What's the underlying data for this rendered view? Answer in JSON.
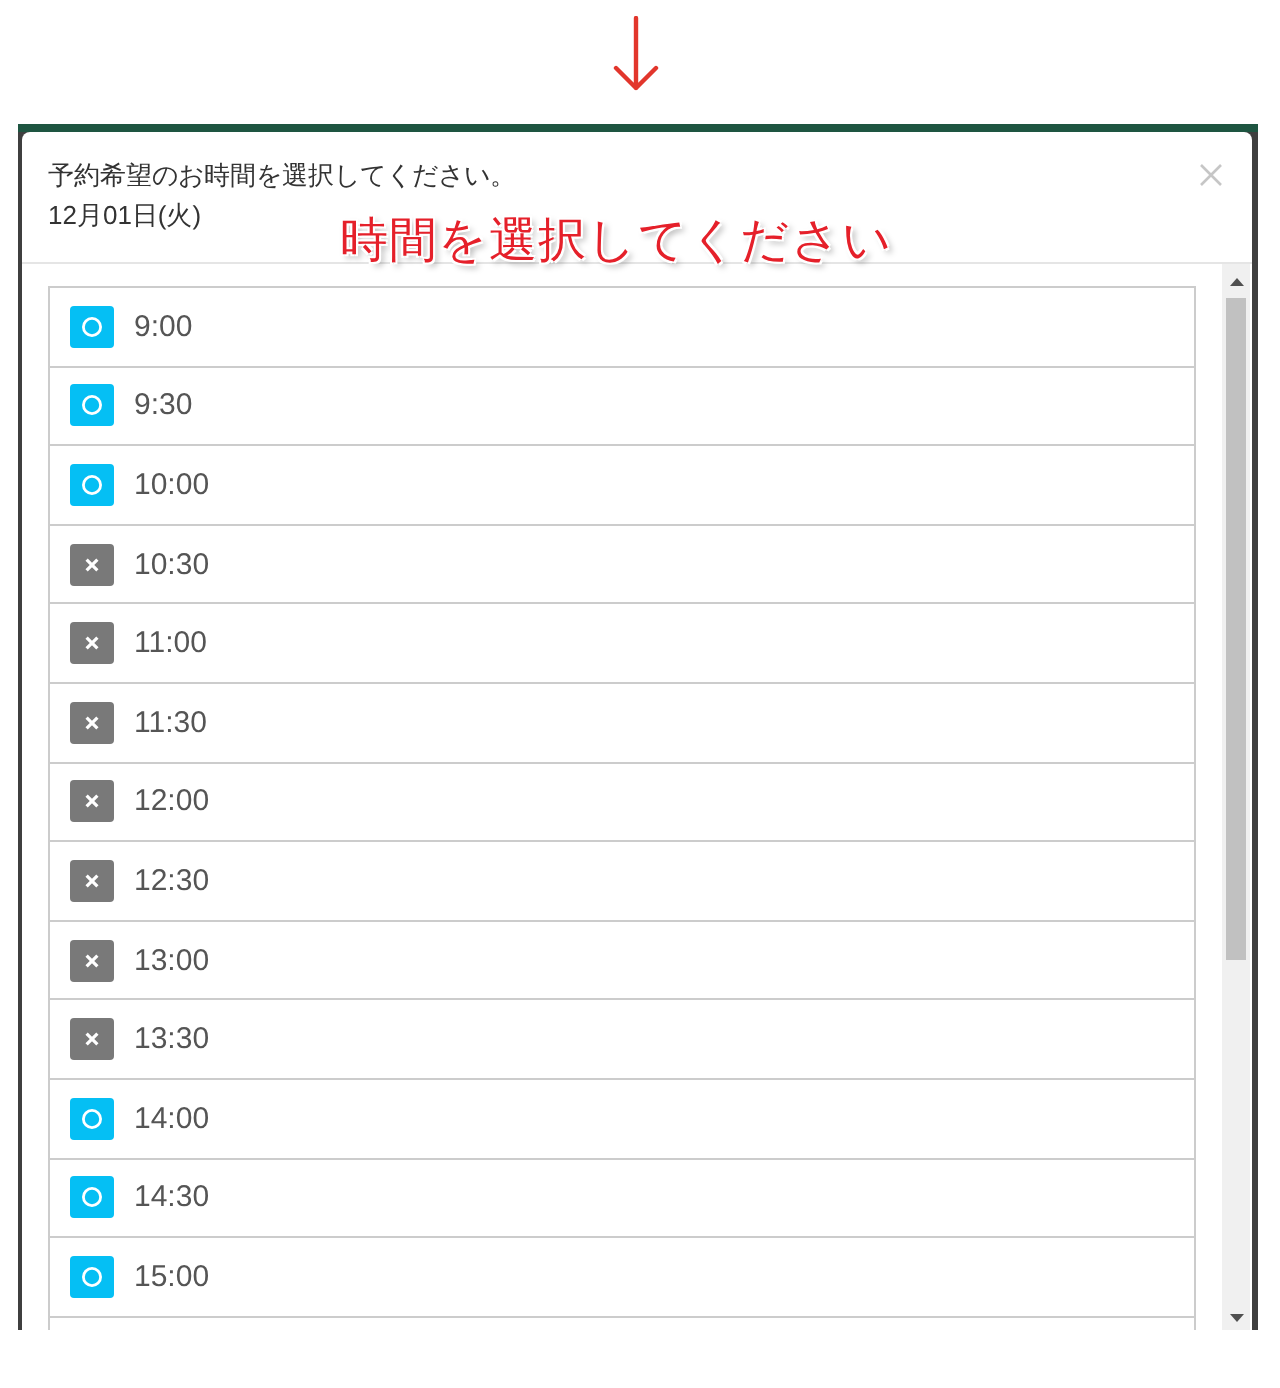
{
  "annotation": {
    "text": "時間を選択してください"
  },
  "dialog": {
    "title": "予約希望のお時間を選択してください。",
    "date": "12月01日(火)"
  },
  "time_slots": [
    {
      "time": "9:00",
      "available": true
    },
    {
      "time": "9:30",
      "available": true
    },
    {
      "time": "10:00",
      "available": true
    },
    {
      "time": "10:30",
      "available": false
    },
    {
      "time": "11:00",
      "available": false
    },
    {
      "time": "11:30",
      "available": false
    },
    {
      "time": "12:00",
      "available": false
    },
    {
      "time": "12:30",
      "available": false
    },
    {
      "time": "13:00",
      "available": false
    },
    {
      "time": "13:30",
      "available": false
    },
    {
      "time": "14:00",
      "available": true
    },
    {
      "time": "14:30",
      "available": true
    },
    {
      "time": "15:00",
      "available": true
    }
  ]
}
